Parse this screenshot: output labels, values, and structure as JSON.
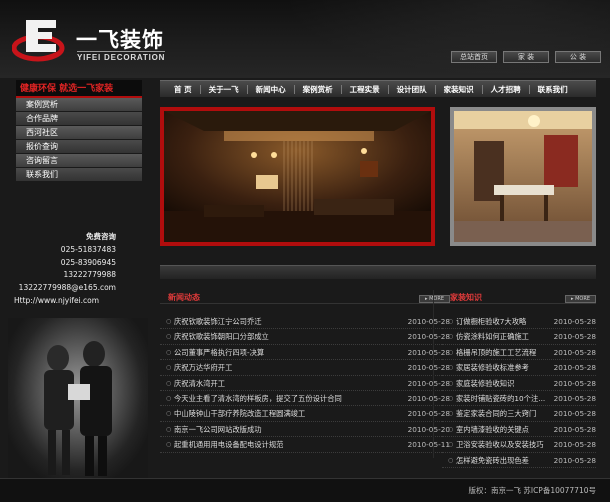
{
  "brand": {
    "name_cn": "一飞装饰",
    "name_en": "YIFEI DECORATION",
    "logo_letter": "E"
  },
  "top_links": [
    "总站首页",
    "家 装",
    "公 装"
  ],
  "sidebar": {
    "heading": "健康环保 就选一飞家装",
    "items": [
      {
        "label": "案例赏析"
      },
      {
        "label": "合作品牌"
      },
      {
        "label": "西河社区"
      },
      {
        "label": "报价查询"
      },
      {
        "label": "咨询留言"
      },
      {
        "label": "联系我们"
      }
    ]
  },
  "contact": {
    "title": "免费咨询",
    "phone1": "025-51837483",
    "phone2": "025-83906945",
    "phone3": "13222779988",
    "email": "13222779988@e165.com",
    "url": "Http://www.njyifei.com"
  },
  "nav": [
    "首 页",
    "关于一飞",
    "新闻中心",
    "案例赏析",
    "工程实景",
    "设计团队",
    "家装知识",
    "人才招聘",
    "联系我们"
  ],
  "news": {
    "title": "新闻动态",
    "more_label": "MORE",
    "items": [
      {
        "text": "庆祝钦歌装饰江宁公司乔迁",
        "date": "2010-05-28"
      },
      {
        "text": "庆祝钦歌装饰朝阳口分部成立",
        "date": "2010-05-28"
      },
      {
        "text": "公司董事严格执行四项-决算",
        "date": "2010-05-28"
      },
      {
        "text": "庆祝万达华府开工",
        "date": "2010-05-28"
      },
      {
        "text": "庆祝清水湾开工",
        "date": "2010-05-28"
      },
      {
        "text": "今天业主看了清水湾的样板房，提交了五份设计合同",
        "date": "2010-05-28"
      },
      {
        "text": "中山陵钟山干部疗养院改造工程圆满竣工",
        "date": "2010-05-28"
      },
      {
        "text": "南京一飞公司网站改版成功",
        "date": "2010-05-20"
      },
      {
        "text": "起重机通用用电设备配电设计规范",
        "date": "2010-05-11"
      }
    ]
  },
  "knowledge": {
    "title": "家装知识",
    "more_label": "MORE",
    "items": [
      {
        "text": "订做橱柜验收7大攻略",
        "date": "2010-05-28"
      },
      {
        "text": "仿瓷涂料如何正确施工",
        "date": "2010-05-28"
      },
      {
        "text": "格栅吊顶的施工工艺流程",
        "date": "2010-05-28"
      },
      {
        "text": "家居装修验收标准参考",
        "date": "2010-05-28"
      },
      {
        "text": "家庭装修验收知识",
        "date": "2010-05-28"
      },
      {
        "text": "家装时铺贴瓷砖的10个注...",
        "date": "2010-05-28"
      },
      {
        "text": "鉴定家装合同的三大窍门",
        "date": "2010-05-28"
      },
      {
        "text": "室内墙漆验收的关键点",
        "date": "2010-05-28"
      },
      {
        "text": "卫浴安装验收以及安装技巧",
        "date": "2010-05-28"
      },
      {
        "text": "怎样避免瓷砖出现色差",
        "date": "2010-05-28"
      }
    ]
  },
  "footer": {
    "text": "版权：南京一飞 苏ICP备10077710号"
  },
  "colors": {
    "accent_red": "#b10d0d",
    "title_red": "#e03a3a",
    "background": "#1a1a1a"
  }
}
